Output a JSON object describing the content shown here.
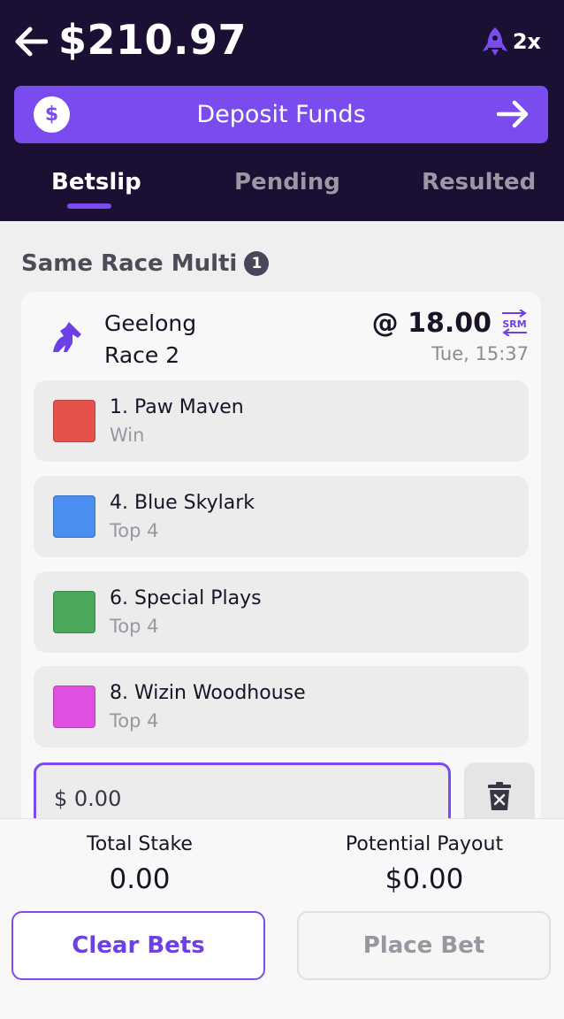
{
  "header": {
    "balance": "$210.97",
    "boost_label": "2x",
    "deposit_label": "Deposit Funds",
    "deposit_icon": "$"
  },
  "tabs": [
    {
      "label": "Betslip",
      "active": true
    },
    {
      "label": "Pending",
      "active": false
    },
    {
      "label": "Resulted",
      "active": false
    }
  ],
  "section": {
    "title": "Same Race Multi",
    "count": "1"
  },
  "race": {
    "venue": "Geelong",
    "race": "Race 2",
    "odds": "@ 18.00",
    "time": "Tue, 15:37",
    "badge": "SRM"
  },
  "selections": [
    {
      "name": "1. Paw Maven",
      "type": "Win",
      "color": "#e4504a"
    },
    {
      "name": "4. Blue Skylark",
      "type": "Top 4",
      "color": "#4a8ef0"
    },
    {
      "name": "6. Special Plays",
      "type": "Top 4",
      "color": "#4aa85a"
    },
    {
      "name": "8. Wizin Woodhouse",
      "type": "Top 4",
      "color": "#e050e0"
    }
  ],
  "stake_input": {
    "value": "$ 0.00"
  },
  "footer": {
    "total_stake_label": "Total Stake",
    "total_stake_value": "0.00",
    "payout_label": "Potential Payout",
    "payout_value": "$0.00",
    "clear_label": "Clear Bets",
    "place_label": "Place Bet"
  },
  "colors": {
    "accent": "#7a4cf0",
    "header_bg": "#1b0f33"
  }
}
